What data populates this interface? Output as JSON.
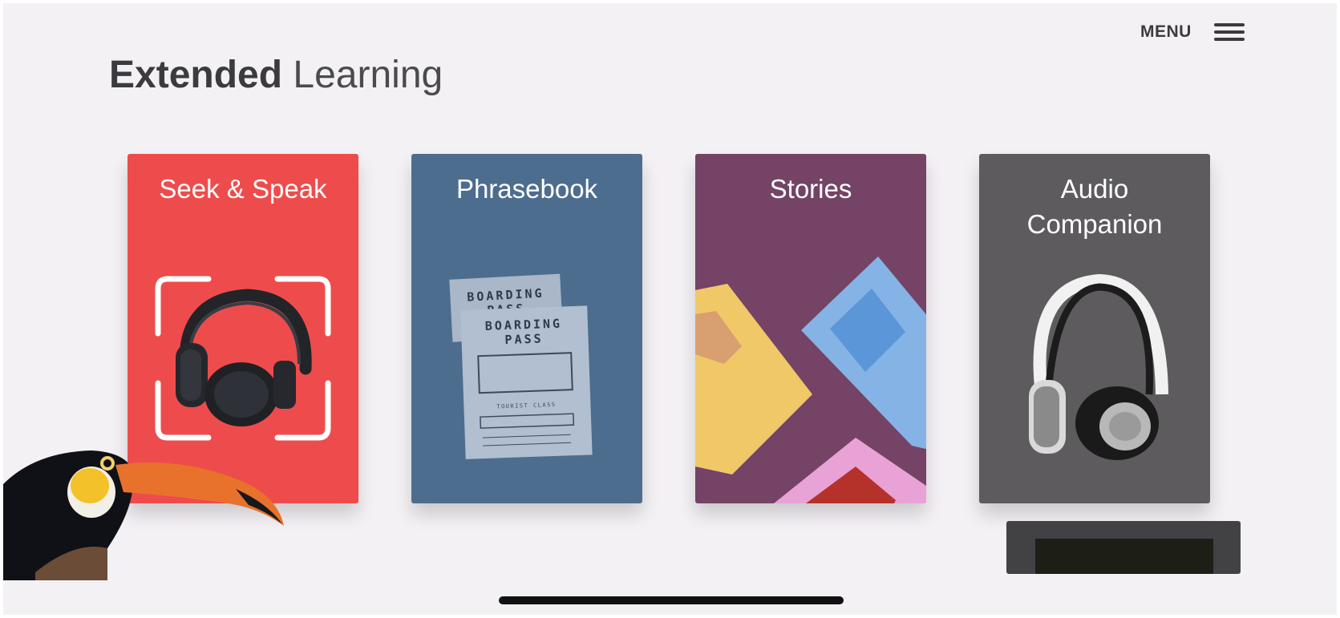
{
  "header": {
    "menu_label": "MENU",
    "title_bold": "Extended",
    "title_light": "Learning"
  },
  "cards": [
    {
      "title": "Seek & Speak",
      "color": "#ee4c4c",
      "art": "headphones-in-scan-frame"
    },
    {
      "title": "Phrasebook",
      "color": "#4d6d8e",
      "art": "boarding-passes"
    },
    {
      "title": "Stories",
      "color": "#744366",
      "art": "story-books"
    },
    {
      "title": "Audio Companion",
      "color": "#5d5b5e",
      "art": "headphones"
    }
  ],
  "boarding_pass": {
    "heading": "BOARDING PASS",
    "class_text": "TOURIST CLASS"
  },
  "icons": {
    "menu": "hamburger-icon",
    "mascot": "toucan-illustration"
  },
  "colors": {
    "background": "#f3f1f4",
    "text": "#3b3b3f"
  }
}
